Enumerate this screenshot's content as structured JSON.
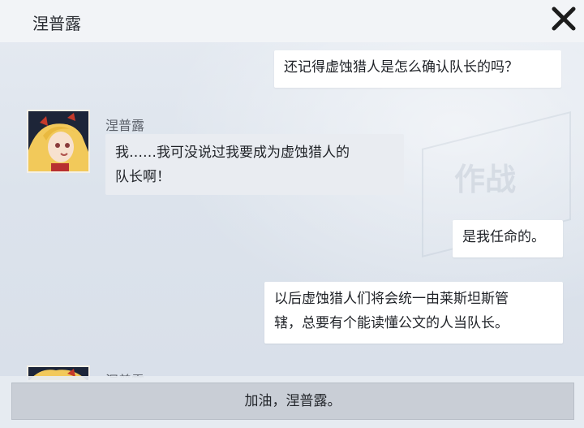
{
  "header": {
    "title": "涅普露"
  },
  "close": {
    "icon": "close-icon"
  },
  "messages": {
    "m1": {
      "text": "还记得虚蚀猎人是怎么确认队长的吗？"
    },
    "m2": {
      "sender": "涅普露",
      "line1": "我……我可没说过我要成为虚蚀猎人的",
      "line2": "队长啊！"
    },
    "m3": {
      "text": "是我任命的。"
    },
    "m4": {
      "line1": "以后虚蚀猎人们将会统一由莱斯坦斯管",
      "line2": "辖，总要有个能读懂公文的人当队长。"
    },
    "m5": {
      "sender": "涅普露"
    }
  },
  "reply": {
    "option": "加油，涅普露。"
  },
  "background": {
    "watermark": "作战"
  }
}
